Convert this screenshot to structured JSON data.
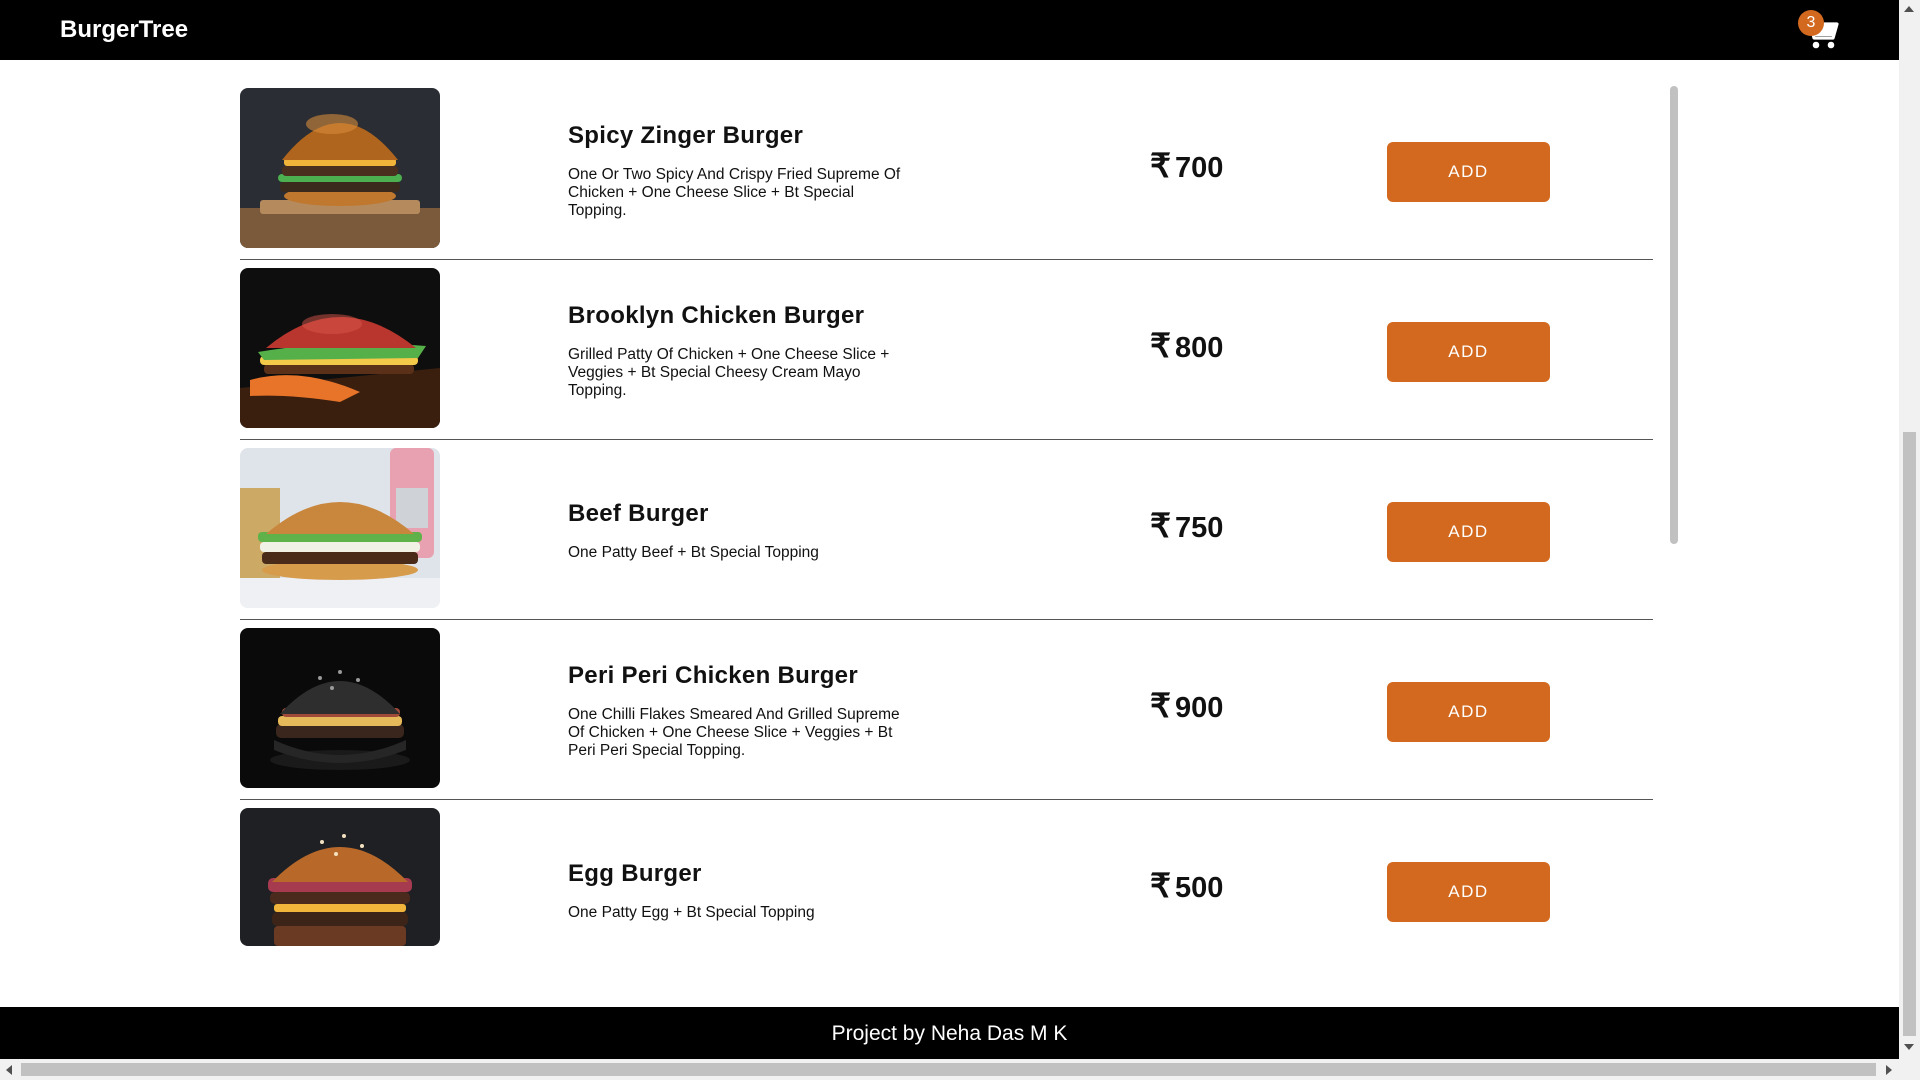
{
  "header": {
    "brand": "BurgerTree",
    "cart_count": "3",
    "cart_icon": "shopping-cart-icon"
  },
  "menu": {
    "currency_symbol": "₹",
    "add_label": "ADD",
    "items": [
      {
        "name": "Spicy Zinger Burger",
        "description": "One Or Two Spicy And Crispy Fried Supreme Of Chicken + One Cheese Slice + Bt Special Topping.",
        "price": "700"
      },
      {
        "name": "Brooklyn Chicken Burger",
        "description": "Grilled Patty Of Chicken + One Cheese Slice + Veggies + Bt Special Cheesy Cream Mayo Topping.",
        "price": "800"
      },
      {
        "name": "Beef Burger",
        "description": "One Patty Beef + Bt Special Topping",
        "price": "750"
      },
      {
        "name": "Peri Peri Chicken Burger",
        "description": "One Chilli Flakes Smeared And Grilled Supreme Of Chicken + One Cheese Slice + Veggies + Bt Peri Peri Special Topping.",
        "price": "900"
      },
      {
        "name": "Egg Burger",
        "description": "One Patty Egg + Bt Special Topping",
        "price": "500"
      }
    ]
  },
  "footer": {
    "text": "Project by Neha Das M K"
  },
  "colors": {
    "accent": "#d2691e",
    "header_bg": "#000000",
    "footer_bg": "#000000"
  }
}
